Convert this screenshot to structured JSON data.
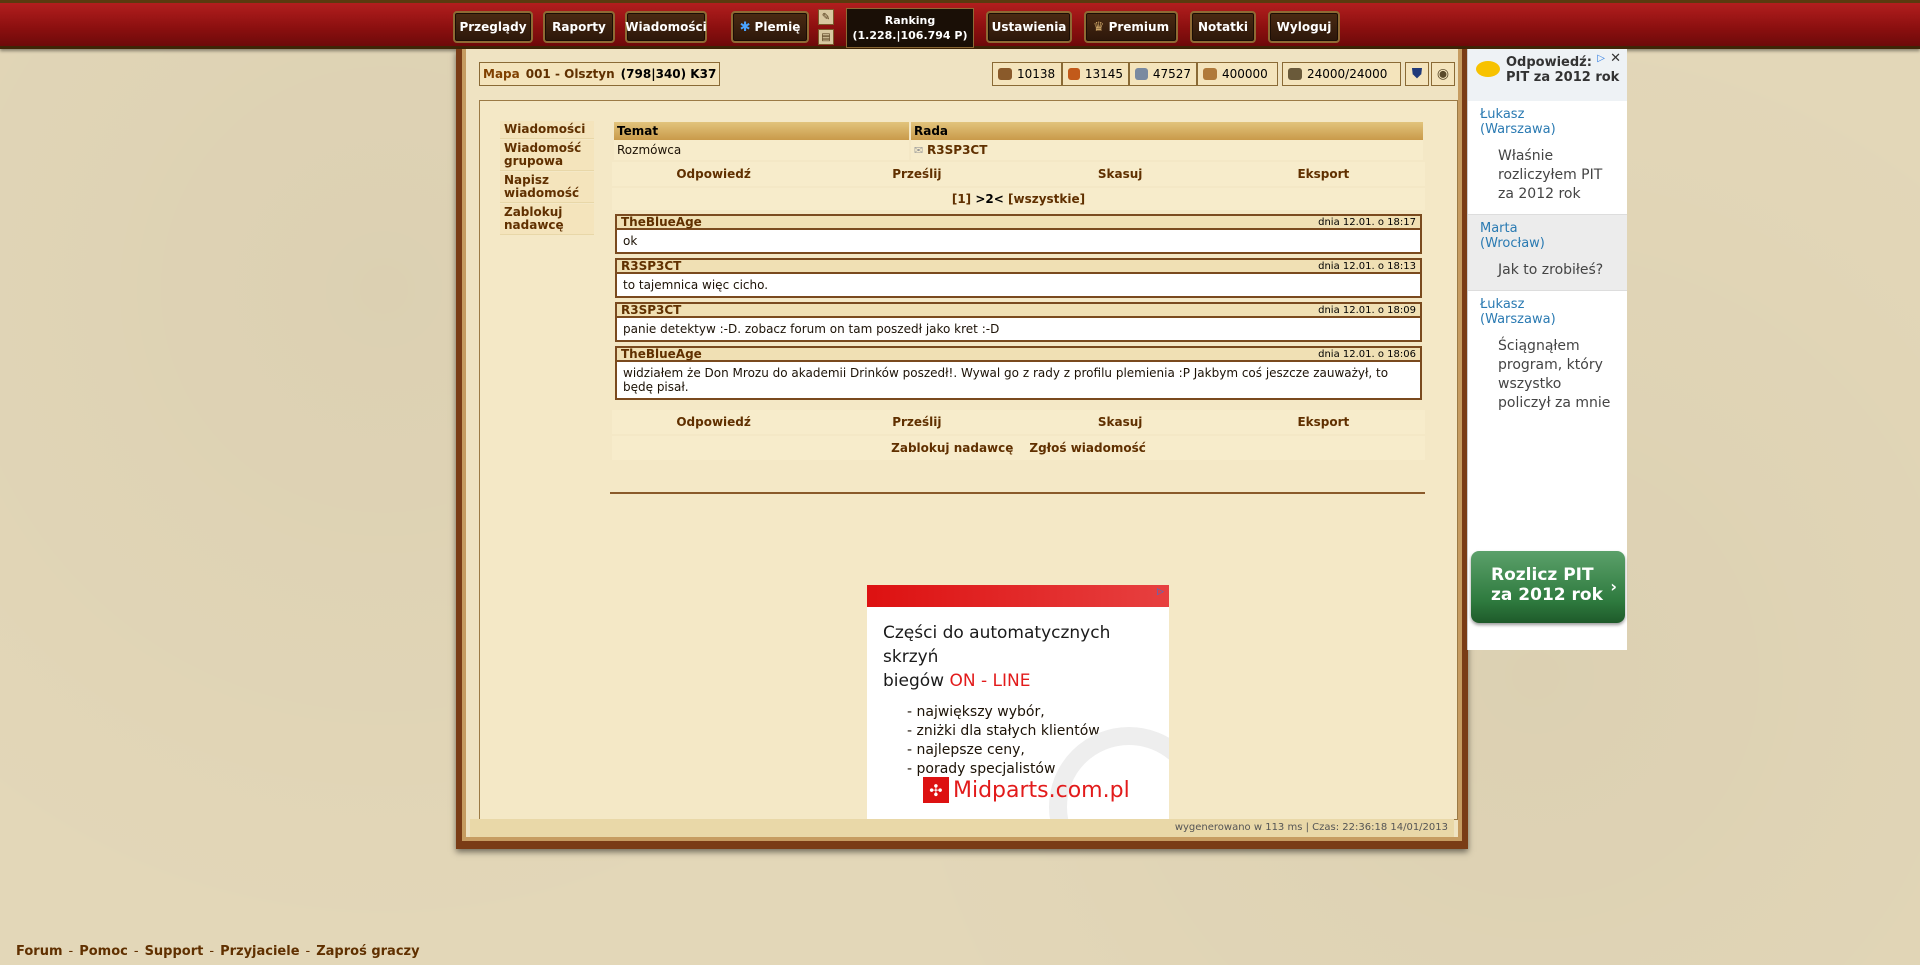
{
  "menu": {
    "items": [
      "Przeglądy",
      "Raporty",
      "Wiadomości",
      "Plemię",
      "Ustawienia",
      "Premium",
      "Notatki",
      "Wyloguj"
    ],
    "ranking_label": "Ranking",
    "ranking_value": "(1.228.|106.794 P)"
  },
  "village": {
    "map_label": "Mapa",
    "name": "001 - Olsztyn",
    "coords": "(798|340) K37"
  },
  "resources": {
    "wood": "10138",
    "clay": "13145",
    "iron": "47527",
    "storage": "400000",
    "farm": "24000/24000"
  },
  "sidebar": {
    "items": [
      "Wiadomości",
      "Wiadomość grupowa",
      "Napisz wiadomość",
      "Zablokuj nadawcę"
    ]
  },
  "message": {
    "col_subject": "Temat",
    "col_subject_value": "Rada",
    "label_partner": "Rozmówca",
    "partner": "R3SP3CT",
    "actions": [
      "Odpowiedź",
      "Prześlij",
      "Skasuj",
      "Eksport"
    ],
    "pager": {
      "p1": "[1]",
      "p2": ">2<",
      "all": "[wszystkie]"
    },
    "posts": [
      {
        "author": "TheBlueAge",
        "date": "dnia 12.01. o 18:17",
        "text": "ok"
      },
      {
        "author": "R3SP3CT",
        "date": "dnia 12.01. o 18:13",
        "text": "to tajemnica więc cicho."
      },
      {
        "author": "R3SP3CT",
        "date": "dnia 12.01. o 18:09",
        "text": "panie detektyw :-D. zobacz forum on tam poszedł jako kret :-D"
      },
      {
        "author": "TheBlueAge",
        "date": "dnia 12.01. o 18:06",
        "text": "widziałem że Don Mrozu do akademii Drinków poszedł!. Wywal go z rady z profilu plemienia :P Jakbym coś jeszcze zauważył, to będę pisał."
      }
    ],
    "extra_actions": [
      "Zablokuj nadawcę",
      "Zgłoś wiadomość"
    ]
  },
  "ad_center": {
    "title_line1": "Części do automatycznych skrzyń",
    "title_line2_black": "biegów ",
    "title_line2_red": "ON - LINE",
    "bullets": [
      "- największy wybór,",
      "- zniżki dla stałych klientów,",
      "- najlepsze ceny,",
      "- porady specjalistów"
    ],
    "logo": "Midparts.com.pl"
  },
  "footer_status": "wygenerowano w 113 ms | Czas: 22:36:18 14/01/2013",
  "ad_right": {
    "header_line1": "Odpowiedź:",
    "header_line2": "PIT za 2012 rok",
    "messages": [
      {
        "who": "Łukasz (Warszawa)",
        "text": "Właśnie rozliczyłem PIT za 2012 rok"
      },
      {
        "who": "Marta (Wrocław)",
        "text": "Jak to zrobiłeś?"
      },
      {
        "who": "Łukasz (Warszawa)",
        "text": "Ściągnąłem program, który wszystko policzył za mnie"
      }
    ],
    "cta_line1": "Rozlicz PIT",
    "cta_line2": "za 2012 rok"
  },
  "bottom_links": [
    "Forum",
    "Pomoc",
    "Support",
    "Przyjaciele",
    "Zaproś graczy"
  ]
}
